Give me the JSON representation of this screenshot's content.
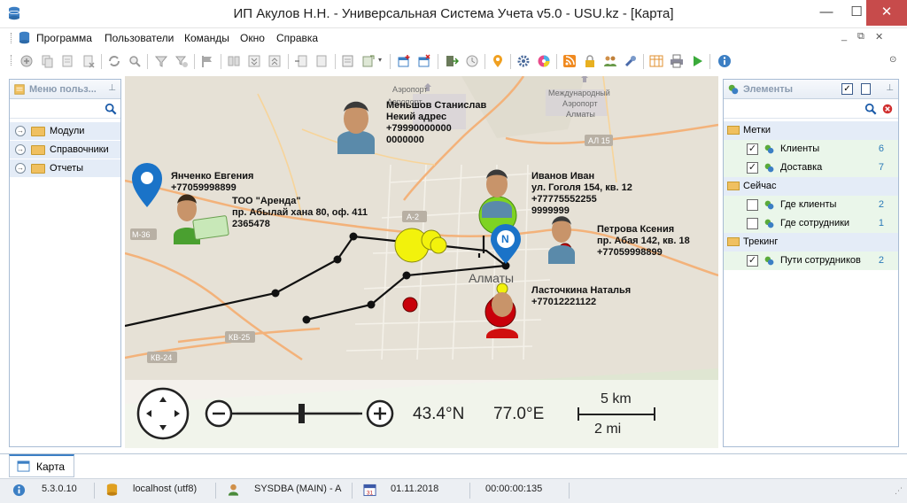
{
  "window": {
    "title": "ИП Акулов Н.Н. - Универсальная Система Учета v5.0 - USU.kz - [Карта]",
    "minimize": "—",
    "maximize": "☐",
    "close": "✕"
  },
  "menu": {
    "items": [
      "Программа",
      "Пользователи",
      "Команды",
      "Окно",
      "Справка"
    ],
    "mdi_controls": [
      "_",
      "⧉",
      "✕"
    ]
  },
  "left_panel": {
    "title": "Меню польз...",
    "items": [
      "Модули",
      "Справочники",
      "Отчеты"
    ]
  },
  "map": {
    "labels": [
      "Меньшов Станислав\nНекий адрес\n+79990000000\n0000000",
      "Янченко Евгения\n+77059998899",
      "ТОО \"Аренда\"\nпр. Абылай хана 80, оф. 411\n2365478",
      "Иванов Иван\nул. Гоголя 154, кв. 12\n+77775552255\n9999999",
      "Петрова Ксения\nпр. Абая 142, кв. 18\n+77059998899",
      "Ласточкина Наталья\n+77012221122"
    ],
    "places": [
      "Аэропорт",
      "Аэропорт",
      "Международный",
      "Аэропорт",
      "Алматы",
      "Алматы"
    ],
    "city": "Алматы",
    "road_labels": [
      "М-36",
      "А-2",
      "АЛ 15",
      "КВ-25",
      "КВ-24"
    ],
    "pin_letter": "N",
    "latitude": "43.4°N",
    "longitude": "77.0°E",
    "scale_km": "5 km",
    "scale_mi": "2 mi"
  },
  "right_panel": {
    "title": "Элементы",
    "groups": [
      {
        "name": "Метки",
        "items": [
          {
            "label": "Клиенты",
            "count": "6",
            "checked": true
          },
          {
            "label": "Доставка",
            "count": "7",
            "checked": true
          }
        ]
      },
      {
        "name": "Сейчас",
        "items": [
          {
            "label": "Где клиенты",
            "count": "2",
            "checked": false
          },
          {
            "label": "Где сотрудники",
            "count": "1",
            "checked": false
          }
        ]
      },
      {
        "name": "Трекинг",
        "items": [
          {
            "label": "Пути сотрудников",
            "count": "2",
            "checked": true
          }
        ]
      }
    ]
  },
  "tabs": {
    "active": "Карта"
  },
  "status": {
    "version": "5.3.0.10",
    "database": "localhost (utf8)",
    "user": "SYSDBA (MAIN) - A",
    "date": "01.11.2018",
    "timer": "00:00:00:135"
  },
  "colors": {
    "accent": "#3c7fc4",
    "pin": "#1a73c8",
    "marker_green": "#7ed321",
    "marker_yellow": "#f2f20c",
    "marker_red": "#c8000a"
  }
}
